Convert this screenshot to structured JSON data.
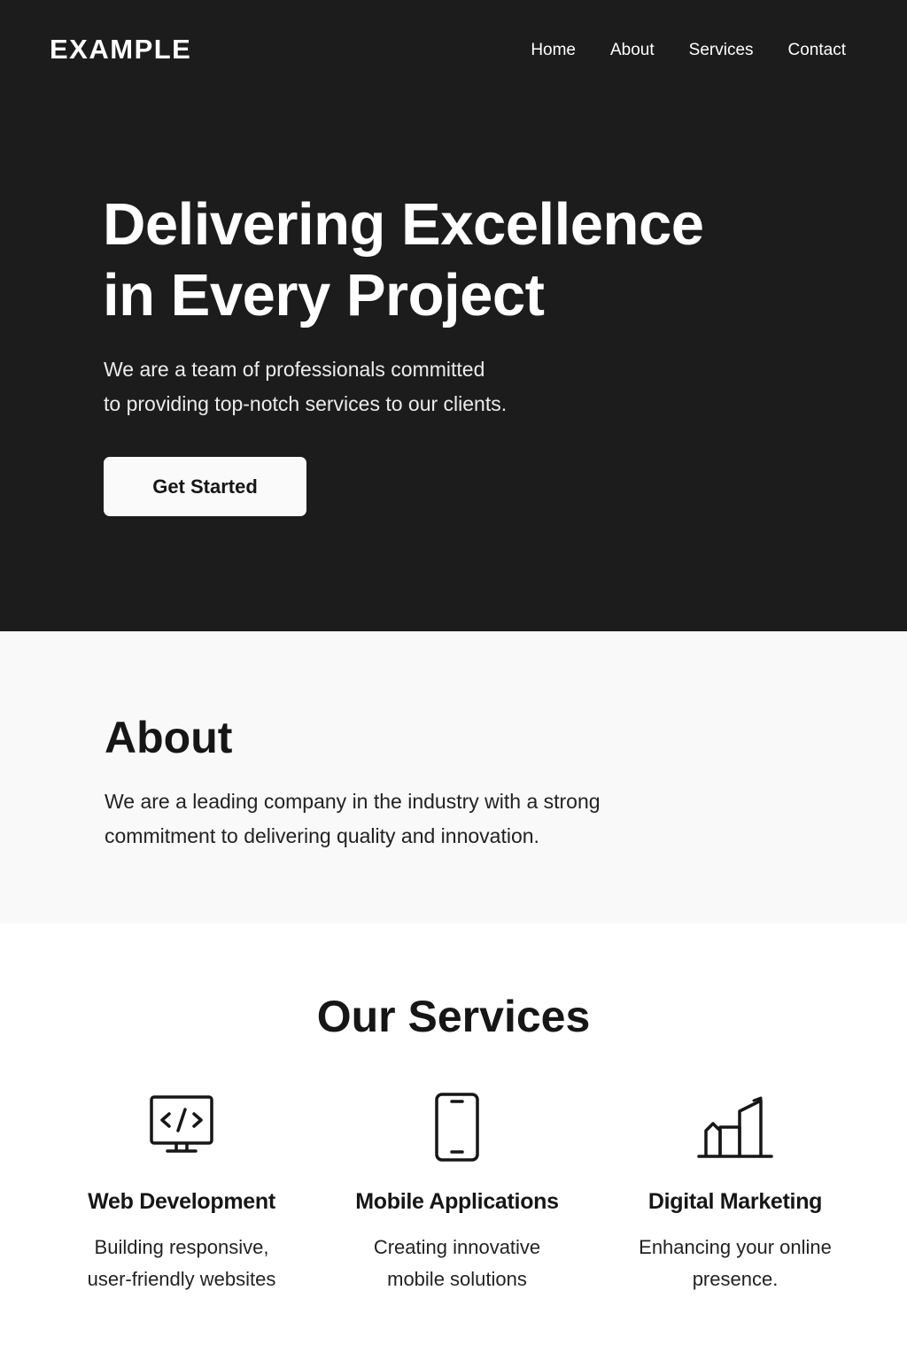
{
  "header": {
    "logo": "EXAMPLE",
    "nav": [
      "Home",
      "About",
      "Services",
      "Contact"
    ]
  },
  "hero": {
    "title_line1": "Delivering Excellence",
    "title_line2": "in Every Project",
    "subtitle_line1": "We are a team of professionals committed",
    "subtitle_line2": "to providing top-notch services to our clients.",
    "cta_label": "Get Started"
  },
  "about": {
    "title": "About",
    "text_line1": "We are a leading company in the industry with a strong",
    "text_line2": "commitment to delivering quality and innovation."
  },
  "services": {
    "title": "Our Services",
    "items": [
      {
        "icon": "code-monitor-icon",
        "title": "Web Development",
        "desc_line1": "Building responsive,",
        "desc_line2": "user-friendly websites"
      },
      {
        "icon": "smartphone-icon",
        "title": "Mobile Applications",
        "desc_line1": "Creating innovative",
        "desc_line2": "mobile solutions"
      },
      {
        "icon": "growth-chart-icon",
        "title": "Digital Marketing",
        "desc_line1": "Enhancing your online",
        "desc_line2": "presence."
      }
    ]
  },
  "colors": {
    "hero_background": "#1c1c1c",
    "about_background": "#f9f9f9",
    "services_background": "#ffffff",
    "text_dark": "#161616",
    "button_background": "#fafafa"
  }
}
